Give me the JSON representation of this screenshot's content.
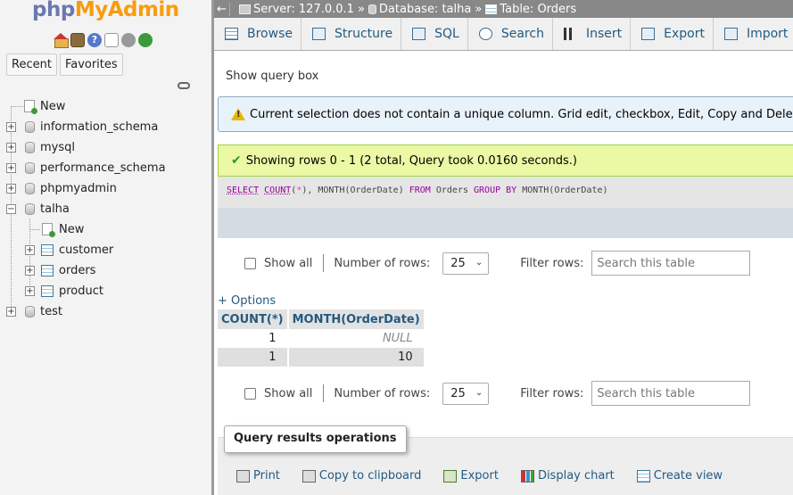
{
  "logo": {
    "php": "php",
    "myadmin": "MyAdmin"
  },
  "left_icons": [
    "home-icon",
    "exit-icon",
    "help-icon",
    "docs-icon",
    "settings-icon",
    "reload-icon"
  ],
  "navtabs": {
    "recent": "Recent",
    "favorites": "Favorites"
  },
  "tree": {
    "new": "New",
    "databases": [
      {
        "name": "information_schema",
        "expanded": false
      },
      {
        "name": "mysql",
        "expanded": false
      },
      {
        "name": "performance_schema",
        "expanded": false
      },
      {
        "name": "phpmyadmin",
        "expanded": false
      },
      {
        "name": "talha",
        "expanded": true
      },
      {
        "name": "test",
        "expanded": false
      }
    ],
    "talha_children": {
      "new": "New",
      "tables": [
        "customer",
        "orders",
        "product"
      ]
    }
  },
  "breadcrumb": {
    "collapse": "←",
    "server": "Server: 127.0.0.1",
    "sep1": "»",
    "database": "Database: talha",
    "sep2": "»",
    "table": "Table: Orders"
  },
  "tabs": {
    "browse": "Browse",
    "structure": "Structure",
    "sql": "SQL",
    "search": "Search",
    "insert": "Insert",
    "export": "Export",
    "import": "Import"
  },
  "content": {
    "show_query_box": "Show query box",
    "notice": "Current selection does not contain a unique column. Grid edit, checkbox, Edit, Copy and Delete features are not available.",
    "success": "Showing rows 0 - 1 (2 total, Query took 0.0160 seconds.)",
    "sql": {
      "select": "SELECT",
      "count": "COUNT",
      "lparen": "(",
      "star": "*",
      "rest1": "), MONTH(OrderDate) ",
      "from": "FROM",
      "rest2": " Orders ",
      "group_by": "GROUP BY",
      "rest3": " MONTH(OrderDate)"
    },
    "nav": {
      "show_all": "Show all",
      "number_of_rows": "Number of rows:",
      "rows_value": "25",
      "filter_rows": "Filter rows:",
      "filter_placeholder": "Search this table"
    },
    "options": "+ Options",
    "results": {
      "columns": [
        "COUNT(*)",
        "MONTH(OrderDate)"
      ],
      "rows": [
        [
          "1",
          "NULL"
        ],
        [
          "1",
          "10"
        ]
      ]
    },
    "qro": {
      "legend": "Query results operations",
      "print": "Print",
      "copy": "Copy to clipboard",
      "export": "Export",
      "chart": "Display chart",
      "view": "Create view"
    }
  }
}
